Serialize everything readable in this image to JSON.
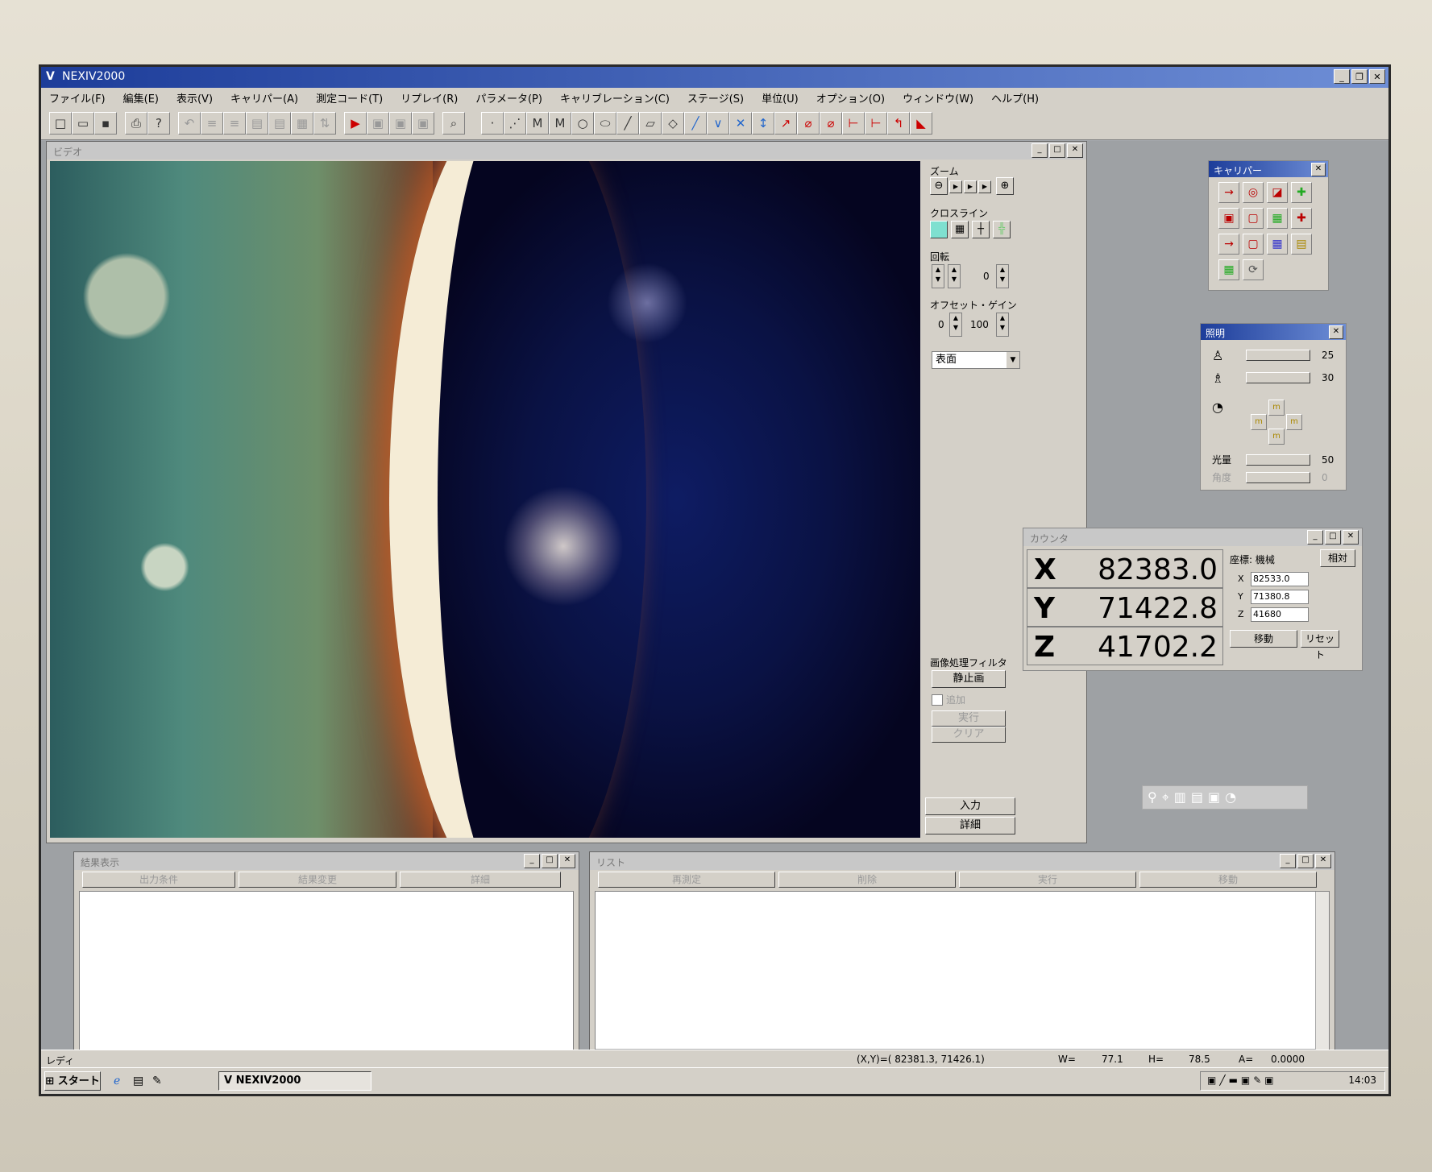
{
  "app": {
    "title": "NEXIV2000",
    "icon": "nexiv-icon"
  },
  "menu": [
    "ファイル(F)",
    "編集(E)",
    "表示(V)",
    "キャリパー(A)",
    "測定コード(T)",
    "リプレイ(R)",
    "パラメータ(P)",
    "キャリブレーション(C)",
    "ステージ(S)",
    "単位(U)",
    "オプション(O)",
    "ウィンドウ(W)",
    "ヘルプ(H)"
  ],
  "video": {
    "caption": "ビデオ",
    "zoom_label": "ズーム",
    "crossline_label": "クロスライン",
    "rotate_label": "回転",
    "rotate_value": "0",
    "offset_gain_label": "オフセット・ゲイン",
    "offset_value": "0",
    "gain_value": "100",
    "surface_select": "表面",
    "filter_label": "画像処理フィルタ",
    "still_button": "静止画",
    "add_checkbox": "追加",
    "execute_button": "実行",
    "clear_button": "クリア",
    "input_button": "入力",
    "detail_button": "詳細"
  },
  "caliper": {
    "caption": "キャリパー"
  },
  "lighting": {
    "caption": "照明",
    "level1": "25",
    "level2": "30",
    "amount_label": "光量",
    "amount_value": "50",
    "angle_label": "角度",
    "angle_value": "0"
  },
  "counter": {
    "caption": "カウンタ",
    "x_label": "X",
    "x_value": "82383.0",
    "y_label": "Y",
    "y_value": "71422.8",
    "z_label": "Z",
    "z_value": "41702.2",
    "coord_label": "座標: 機械",
    "relative_button": "相対",
    "field_x_label": "X",
    "field_x": "82533.0",
    "field_y_label": "Y",
    "field_y": "71380.8",
    "field_z_label": "Z",
    "field_z": "41680",
    "move_button": "移動",
    "reset_button": "リセット"
  },
  "results": {
    "caption": "結果表示",
    "tabs": [
      "出力条件",
      "結果変更",
      "詳細"
    ]
  },
  "list": {
    "caption": "リスト",
    "tabs": [
      "再測定",
      "削除",
      "実行",
      "移動"
    ]
  },
  "status": {
    "ready": "レディ",
    "xy": "(X,Y)=(   82381.3,   71426.1)",
    "w_label": "W=",
    "w_value": "77.1",
    "h_label": "H=",
    "h_value": "78.5",
    "a_label": "A=",
    "a_value": "0.0000"
  },
  "taskbar": {
    "start": "スタート",
    "task": "NEXIV2000",
    "clock": "14:03"
  }
}
